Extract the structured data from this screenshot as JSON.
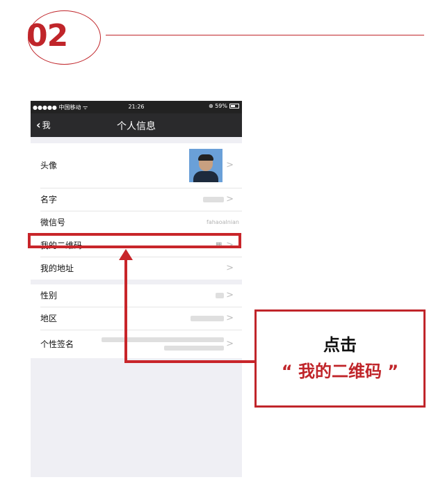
{
  "step": {
    "number": "02"
  },
  "status_bar": {
    "carrier": "●●●●● 中国移动 ᯤ",
    "time": "21:26",
    "battery": "⊕ 59%"
  },
  "nav": {
    "back_label": "我",
    "back_chevron": "‹",
    "title": "个人信息"
  },
  "profile_rows": [
    {
      "label": "头像"
    },
    {
      "label": "名字"
    },
    {
      "label": "微信号",
      "value": "fahaoalnian"
    },
    {
      "label": "我的二维码"
    },
    {
      "label": "我的地址"
    }
  ],
  "detail_rows": [
    {
      "label": "性别"
    },
    {
      "label": "地区"
    },
    {
      "label": "个性签名"
    }
  ],
  "row_chevron": ">",
  "qr_icon_glyph": "▦",
  "callout": {
    "line1": "点击",
    "line2": "“ 我的二维码 ”"
  },
  "colors": {
    "accent": "#c0252a",
    "nav_bg": "#2a2a2c",
    "group_bg": "#efeff4"
  }
}
